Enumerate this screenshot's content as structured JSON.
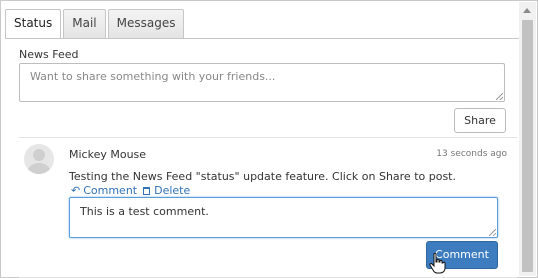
{
  "tabs": [
    {
      "label": "Status",
      "active": true
    },
    {
      "label": "Mail",
      "active": false
    },
    {
      "label": "Messages",
      "active": false
    }
  ],
  "composer": {
    "label": "News Feed",
    "placeholder": "Want to share something with your friends...",
    "share_label": "Share"
  },
  "post": {
    "author": "Mickey Mouse",
    "time": "13 seconds ago",
    "text": "Testing the News Feed \"status\" update feature. Click on Share to post.",
    "actions": {
      "comment_label": "Comment",
      "delete_label": "Delete"
    },
    "comment_value": "This is a test comment.",
    "comment_button_label": "Comment"
  },
  "colors": {
    "accent": "#3c7cbf",
    "link": "#3373b6"
  },
  "icons": [
    "reply-icon",
    "trash-icon",
    "avatar",
    "hand-cursor-icon",
    "resize-grip-icon"
  ]
}
